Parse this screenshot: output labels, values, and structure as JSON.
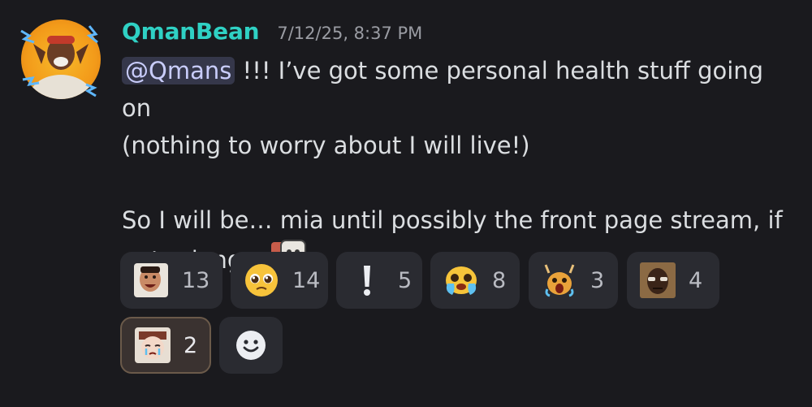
{
  "message": {
    "author": "QmanBean",
    "timestamp": "7/12/25, 8:37 PM",
    "mention": "@Qmans",
    "line1_rest": " !!! I’ve got some personal health stuff going on",
    "line2": "(nothing to worry about I will live!)",
    "line3": "So I will be… mia until possibly the front page stream, if",
    "line4": "not… longer"
  },
  "reactions": [
    {
      "icon": "laughing-man-emote",
      "count": "13"
    },
    {
      "icon": "pleading-face-emoji",
      "count": "14"
    },
    {
      "icon": "exclamation-emoji",
      "count": "5"
    },
    {
      "icon": "crying-face-emote",
      "count": "8"
    },
    {
      "icon": "screaming-cat-emote",
      "count": "3"
    },
    {
      "icon": "man-photo-emote",
      "count": "4"
    },
    {
      "icon": "crying-anime-girl-emote",
      "count": "2"
    }
  ],
  "colors": {
    "background": "#1a1a1e",
    "username": "#2fd1c4",
    "reaction_bg": "#2a2b31",
    "mention_bg": "#35374a"
  }
}
